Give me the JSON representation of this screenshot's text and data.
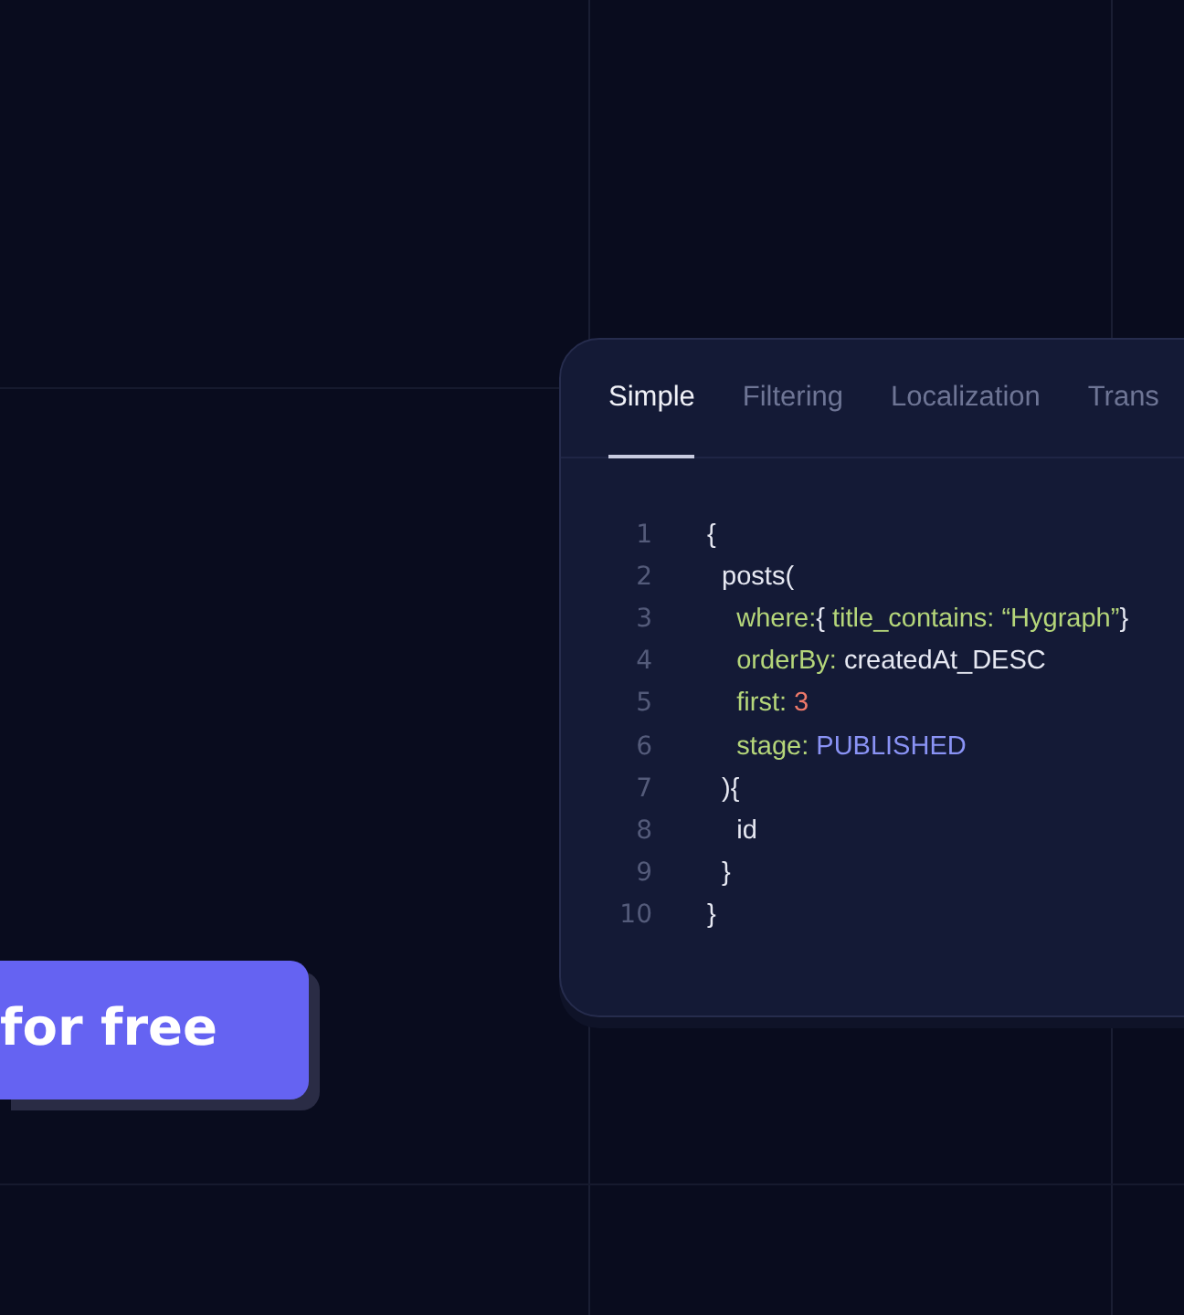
{
  "tabs": [
    {
      "label": "Simple",
      "selected": true
    },
    {
      "label": "Filtering",
      "selected": false
    },
    {
      "label": "Localization",
      "selected": false
    },
    {
      "label": "Trans",
      "selected": false
    }
  ],
  "code_lines": [
    {
      "number": "1",
      "tokens": [
        {
          "text": "{",
          "kind": "plain"
        }
      ]
    },
    {
      "number": "2",
      "tokens": [
        {
          "text": "  posts(",
          "kind": "plain"
        }
      ]
    },
    {
      "number": "3",
      "tokens": [
        {
          "text": "    where:",
          "kind": "key"
        },
        {
          "text": "{ ",
          "kind": "plain"
        },
        {
          "text": "title_contains: “Hygraph”",
          "kind": "key"
        },
        {
          "text": "}",
          "kind": "plain"
        }
      ]
    },
    {
      "number": "4",
      "tokens": [
        {
          "text": "    orderBy:",
          "kind": "key"
        },
        {
          "text": " createdAt_DESC",
          "kind": "plain"
        }
      ]
    },
    {
      "number": "5",
      "tokens": [
        {
          "text": "    first:",
          "kind": "key"
        },
        {
          "text": " 3",
          "kind": "number"
        }
      ]
    },
    {
      "number": "6",
      "tokens": [
        {
          "text": "    stage:",
          "kind": "key"
        },
        {
          "text": " PUBLISHED",
          "kind": "enum"
        }
      ]
    },
    {
      "number": "7",
      "tokens": [
        {
          "text": "  ){",
          "kind": "plain"
        }
      ]
    },
    {
      "number": "8",
      "tokens": [
        {
          "text": "    id",
          "kind": "plain"
        }
      ]
    },
    {
      "number": "9",
      "tokens": [
        {
          "text": "  }",
          "kind": "plain"
        }
      ]
    },
    {
      "number": "10",
      "tokens": [
        {
          "text": "}",
          "kind": "plain"
        }
      ]
    }
  ],
  "cta_button": {
    "label": "for free"
  }
}
